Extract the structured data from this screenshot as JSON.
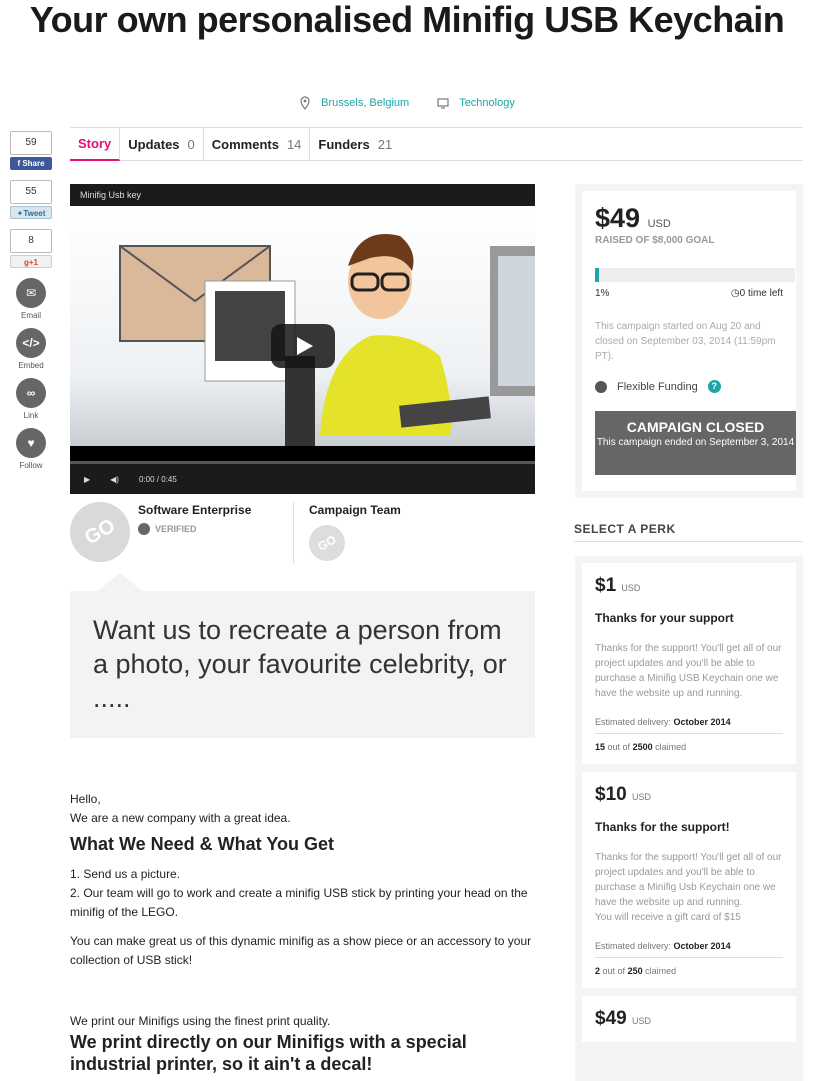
{
  "campaign": {
    "title": "Your own personalised Minifig USB Keychain",
    "location": "Brussels, Belgium",
    "category": "Technology"
  },
  "tabs": [
    {
      "label": "Story",
      "count": ""
    },
    {
      "label": "Updates",
      "count": "0"
    },
    {
      "label": "Comments",
      "count": "14"
    },
    {
      "label": "Funders",
      "count": "21"
    }
  ],
  "social": {
    "fb_count": "59",
    "fb_label": "Share",
    "tw_count": "55",
    "tw_label": "Tweet",
    "gp_count": "8",
    "gp_label": "+1",
    "email_label": "Email",
    "embed_label": "Embed",
    "link_label": "Link",
    "follow_label": "Follow"
  },
  "video": {
    "title": "Minifig Usb key",
    "time": "0:00",
    "duration": "/ 0:45"
  },
  "creator": {
    "name": "Software Enterprise",
    "verified": "VERIFIED",
    "team_label": "Campaign Team",
    "avatar_text": "GO"
  },
  "pitch": "Want us to recreate a person from a photo, your favourite celebrity, or .....",
  "story": {
    "greeting": "Hello,",
    "intro": "We are a new company with a great idea.",
    "heading": "What We Need & What You Get",
    "step1": "1. Send us a picture.",
    "step2": "2. Our team will go to work and create a minifig USB stick by printing your head on the minifig of the LEGO.",
    "para": "You can make great us of this dynamic minifig as a show piece or an accessory to your collection of USB stick!",
    "print": "We print our Minifigs using the finest print quality.",
    "print_heading": "We print directly on our Minifigs with a special industrial printer, so it ain't a decal!"
  },
  "funding": {
    "amount": "$49",
    "currency": "USD",
    "goal": "RAISED OF $8,000 GOAL",
    "percent": "1%",
    "percent_value": 0.01,
    "time_left": "0 time left",
    "ended_text": "This campaign started on Aug 20 and closed on September 03, 2014 (11:59pm PT).",
    "flexible": "Flexible Funding",
    "help": "?",
    "closed_title": "CAMPAIGN CLOSED",
    "closed_sub": "This campaign ended on September 3, 2014",
    "accent": "#1aa6a6"
  },
  "perks": {
    "heading": "SELECT A PERK",
    "items": [
      {
        "price": "$1",
        "currency": "USD",
        "title": "Thanks for your support",
        "desc": "Thanks for the support! You'll get all of our project updates and you'll be able to purchase a Minifig USB Keychain one we have the website up and running.",
        "delivery_label": "Estimated delivery:",
        "delivery": "October 2014",
        "claimed": "15",
        "claimed_mid": "out of",
        "total": "2500",
        "claimed_suffix": "claimed"
      },
      {
        "price": "$10",
        "currency": "USD",
        "title": "Thanks for the support!",
        "desc": "Thanks for the support! You'll get all of our project updates and you'll be able to purchase a Minifig Usb Keychain one we have the website up and running.",
        "desc2": "You will receive a gift card of $15",
        "delivery_label": "Estimated delivery:",
        "delivery": "October 2014",
        "claimed": "2",
        "claimed_mid": "out of",
        "total": "250",
        "claimed_suffix": "claimed"
      },
      {
        "price": "$49",
        "currency": "USD"
      }
    ]
  },
  "colors": {
    "pink": "#e51075",
    "teal": "#1aa6a6",
    "closed": "#666666"
  }
}
